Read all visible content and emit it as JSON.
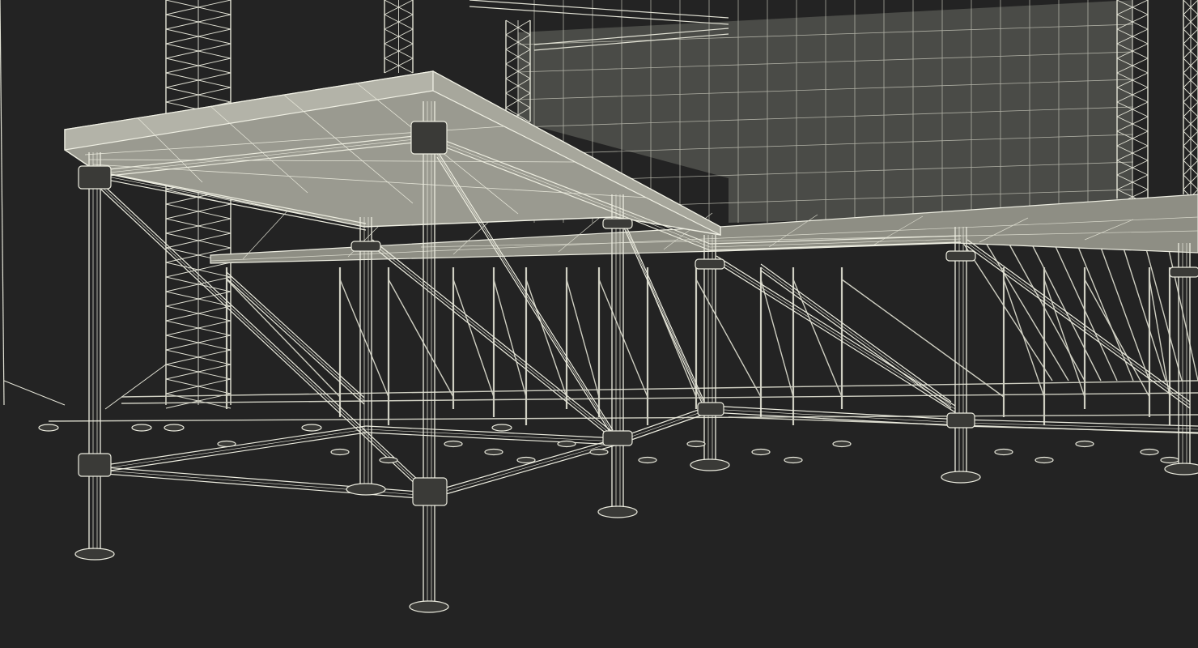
{
  "scene": {
    "subject": "stage-scaffold-wireframe",
    "colors": {
      "background": "#232323",
      "wire": "#e7e7d9",
      "wire_dim": "#bdbdb0",
      "deck_fill": "#8a8a80",
      "screen_fill": "#4a4b47",
      "screen_grid": "#c9c9bc"
    }
  }
}
